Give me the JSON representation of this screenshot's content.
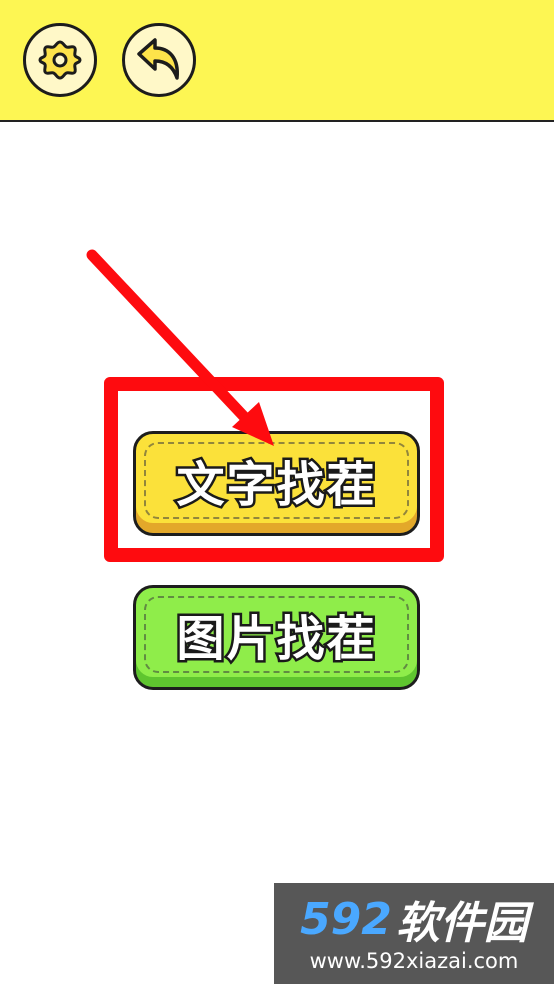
{
  "toolbar": {
    "settings_icon": "gear-icon",
    "back_icon": "back-arrow-icon",
    "background": "#fdf653"
  },
  "menu": {
    "text_mode_label": "文字找茬",
    "image_mode_label": "图片找茬",
    "text_mode_color": "#fbe13a",
    "image_mode_color": "#8fed4a"
  },
  "annotation": {
    "highlight_color": "#fe0b0f"
  },
  "watermark": {
    "number": "592",
    "site_name": "软件园",
    "url": "www.592xiazai.com"
  }
}
